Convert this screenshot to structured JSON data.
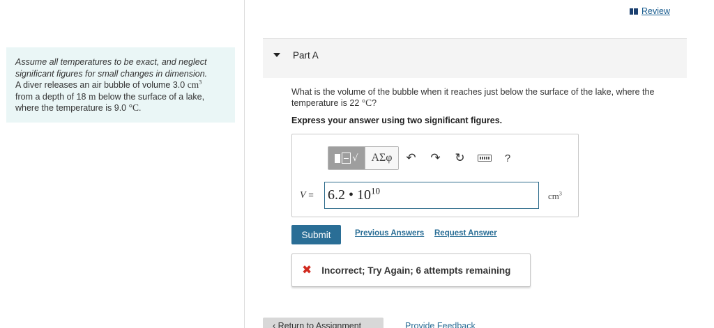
{
  "review": {
    "label": "Review",
    "icon": "book-icon"
  },
  "problem": {
    "note": "Assume all temperatures to be exact, and neglect significant figures for small changes in dimension.",
    "line1": "A diver releases an air bubble of volume 3.0",
    "volume_unit": "cm",
    "volume_unit_exp": "3",
    "line2a": "from a depth of 18",
    "depth_unit": "m",
    "line2b": "below the surface of a lake,",
    "line3a": "where the temperature is 9.0",
    "temp_unit": "°C",
    "line3b": "."
  },
  "part": {
    "title": "Part A",
    "caret_icon": "caret-down-icon"
  },
  "question": {
    "text_a": "What is the volume of the bubble when it reaches just below the surface of the lake, where the temperature is 22",
    "temp_unit": "°C",
    "text_b": "?"
  },
  "instructions": "Express your answer using two significant figures.",
  "toolbar": {
    "symbols_label": "ΑΣφ",
    "undo_icon": "undo-icon",
    "redo_icon": "redo-icon",
    "reset_icon": "reset-icon",
    "keyboard_icon": "keyboard-icon",
    "help_label": "?"
  },
  "answer": {
    "variable": "V",
    "equals": "=",
    "value_mantissa": "6.2 • 10",
    "value_exponent": "10",
    "unit": "cm",
    "unit_exp": "3"
  },
  "actions": {
    "submit_label": "Submit",
    "previous_answers": "Previous Answers",
    "request_answer": "Request Answer"
  },
  "feedback": {
    "icon": "x-icon",
    "text": "Incorrect; Try Again; 6 attempts remaining",
    "color": "#d12a1f"
  },
  "footer": {
    "return_label": "Return to Assignment",
    "provide_feedback": "Provide Feedback"
  },
  "colors": {
    "accent": "#2a6e96",
    "problem_bg": "#eaf6f6"
  }
}
